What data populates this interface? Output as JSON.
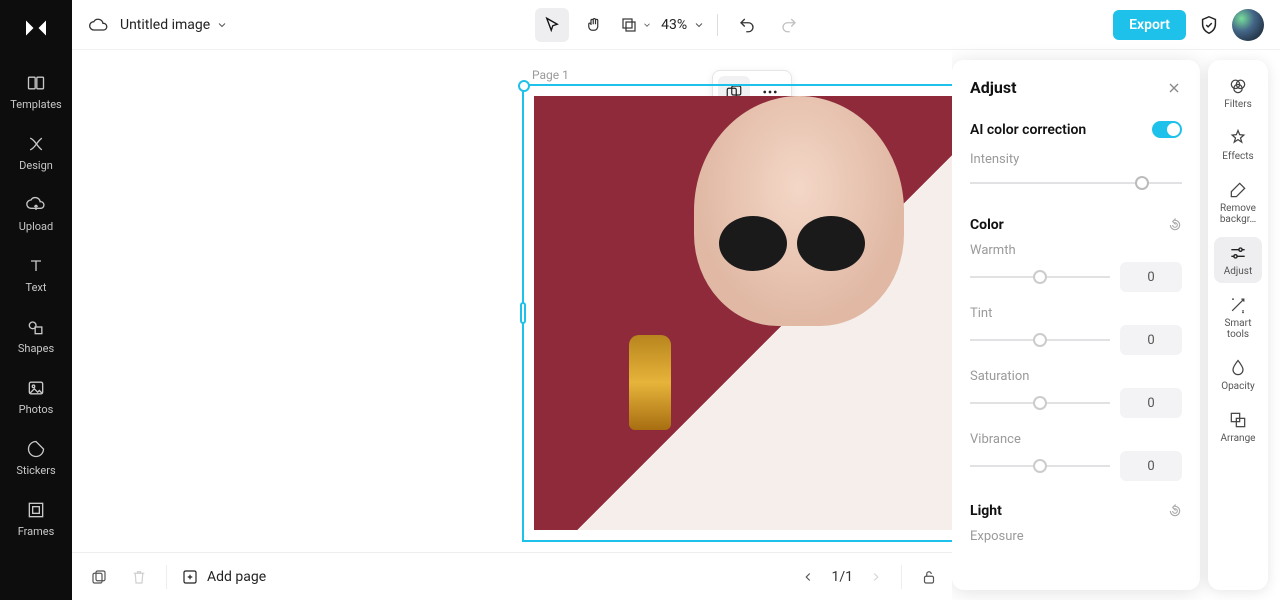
{
  "doc_title": "Untitled image",
  "zoom": "43%",
  "export_label": "Export",
  "page_label": "Page 1",
  "left_rail": [
    {
      "label": "Templates"
    },
    {
      "label": "Design"
    },
    {
      "label": "Upload"
    },
    {
      "label": "Text"
    },
    {
      "label": "Shapes"
    },
    {
      "label": "Photos"
    },
    {
      "label": "Stickers"
    },
    {
      "label": "Frames"
    }
  ],
  "right_rail": [
    {
      "label": "Filters"
    },
    {
      "label": "Effects"
    },
    {
      "label": "Remove backgr…"
    },
    {
      "label": "Adjust"
    },
    {
      "label": "Smart tools"
    },
    {
      "label": "Opacity"
    },
    {
      "label": "Arrange"
    }
  ],
  "bottombar": {
    "add_page": "Add page",
    "page_indicator": "1/1"
  },
  "adjust": {
    "title": "Adjust",
    "ai_label": "AI color correction",
    "intensity_label": "Intensity",
    "color_section": "Color",
    "light_section": "Light",
    "warmth": {
      "label": "Warmth",
      "value": "0"
    },
    "tint": {
      "label": "Tint",
      "value": "0"
    },
    "saturation": {
      "label": "Saturation",
      "value": "0"
    },
    "vibrance": {
      "label": "Vibrance",
      "value": "0"
    },
    "exposure_label": "Exposure"
  }
}
